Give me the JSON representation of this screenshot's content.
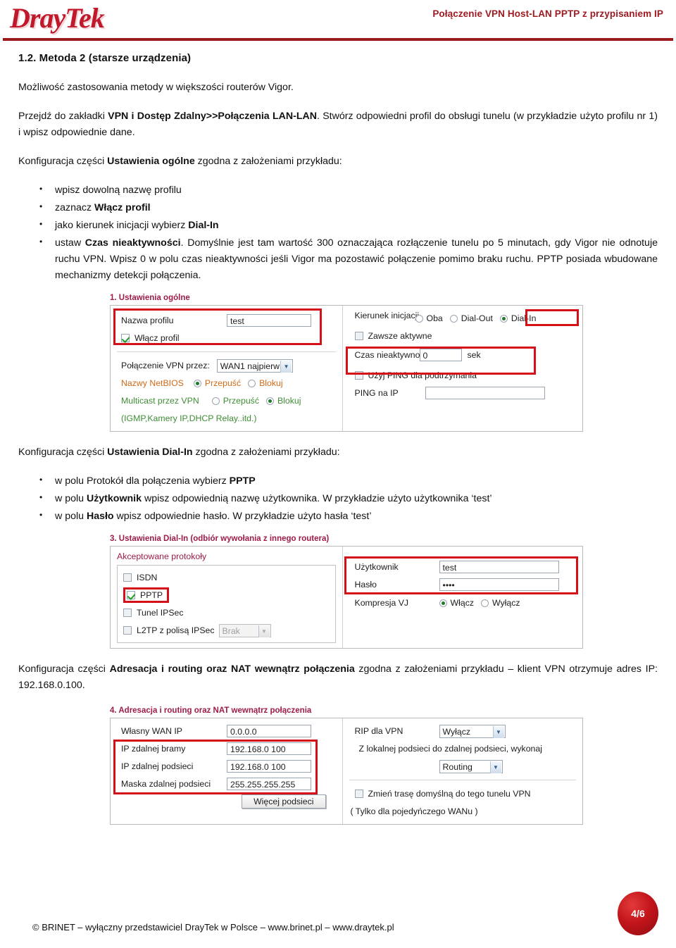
{
  "header": {
    "logo_text": "DrayTek",
    "title": "Połączenie VPN Host-LAN PPTP z przypisaniem IP"
  },
  "section": {
    "heading": "1.2. Metoda 2 (starsze urządzenia)",
    "intro": "Możliwość zastosowania metody w większości routerów Vigor.",
    "nav_para_pre": "Przejdź do zakładki ",
    "nav_para_bold": "VPN i Dostęp Zdalny>>Połączenia LAN-LAN",
    "nav_para_post": ". Stwórz odpowiedni profil do obsługi tunelu (w przykładzie użyto profilu nr 1) i wpisz odpowiednie dane."
  },
  "block_general": {
    "lead_pre": "Konfiguracja części ",
    "lead_bold": "Ustawienia ogólne",
    "lead_post": " zgodna z założeniami przykładu:",
    "bullets": [
      {
        "pre": "wpisz dowolną nazwę profilu",
        "bold": "",
        "post": ""
      },
      {
        "pre": "zaznacz ",
        "bold": "Włącz profil",
        "post": ""
      },
      {
        "pre": "jako kierunek inicjacji wybierz ",
        "bold": "Dial-In",
        "post": ""
      },
      {
        "pre": "ustaw ",
        "bold": "Czas nieaktywności",
        "post": ". Domyślnie jest tam wartość 300 oznaczająca rozłączenie tunelu po 5 minutach, gdy Vigor nie odnotuje ruchu VPN. Wpisz 0 w polu czas nieaktywności jeśli Vigor ma pozostawić połączenie pomimo braku ruchu. PPTP posiada wbudowane mechanizmy detekcji połączenia."
      }
    ]
  },
  "fig1": {
    "caption": "1. Ustawienia ogólne",
    "profile_name_label": "Nazwa profilu",
    "profile_name_value": "test",
    "enable_profile_label": "Włącz profil",
    "enable_profile_checked": true,
    "vpn_through_label": "Połączenie VPN przez:",
    "vpn_through_value": "WAN1 najpierw",
    "netbios_label": "Nazwy NetBIOS",
    "netbios_pass": "Przepuść",
    "netbios_block": "Blokuj",
    "netbios_selected": "Przepuść",
    "multicast_label": "Multicast przez VPN",
    "multicast_note": "(IGMP,Kamery IP,DHCP Relay..itd.)",
    "multicast_pass": "Przepuść",
    "multicast_block": "Blokuj",
    "multicast_selected": "Blokuj",
    "direction_label": "Kierunek inicjacji",
    "direction_options": [
      "Oba",
      "Dial-Out",
      "Dial-In"
    ],
    "direction_selected": "Dial-In",
    "always_on_label": "Zawsze aktywne",
    "always_on_checked": false,
    "idle_label": "Czas nieaktywności",
    "idle_value": "0",
    "idle_unit": "sek",
    "ping_keepalive_label": "Użyj PING dla podtrzymania",
    "ping_keepalive_checked": false,
    "ping_ip_label": "PING na IP",
    "ping_ip_value": ""
  },
  "block_dialin": {
    "lead_pre": "Konfiguracja części ",
    "lead_bold": "Ustawienia Dial-In",
    "lead_post": " zgodna z założeniami przykładu:",
    "bullets": [
      {
        "pre": "w polu Protokół dla połączenia wybierz ",
        "bold": "PPTP",
        "post": ""
      },
      {
        "pre": "w polu ",
        "bold": "Użytkownik",
        "post": " wpisz odpowiednią nazwę użytkownika. W przykładzie użyto użytkownika ‘test’"
      },
      {
        "pre": "w polu ",
        "bold": "Hasło",
        "post": " wpisz odpowiednie hasło. W przykładzie użyto hasła ‘test’"
      }
    ]
  },
  "fig3": {
    "caption": "3. Ustawienia Dial-In (odbiór wywołania z innego routera)",
    "protocols_title": "Akceptowane protokoły",
    "protocols": [
      {
        "label": "ISDN",
        "checked": false
      },
      {
        "label": "PPTP",
        "checked": true
      },
      {
        "label": "Tunel IPSec",
        "checked": false
      },
      {
        "label": "L2TP z polisą IPSec",
        "checked": false
      }
    ],
    "l2tp_select_value": "Brak",
    "user_label": "Użytkownik",
    "user_value": "test",
    "password_label": "Hasło",
    "password_value": "••••",
    "vj_label": "Kompresja VJ",
    "vj_on": "Włącz",
    "vj_off": "Wyłącz",
    "vj_selected": "Włącz"
  },
  "block_nat": {
    "lead_pre": "Konfiguracja części ",
    "lead_bold": "Adresacja i routing oraz NAT wewnątrz połączenia",
    "lead_post": " zgodna z założeniami przykładu – klient VPN otrzymuje adres IP: 192.168.0.100."
  },
  "fig4": {
    "caption": "4. Adresacja i routing oraz NAT wewnątrz połączenia",
    "own_wan_ip_label": "Własny WAN IP",
    "own_wan_ip_value": "0.0.0.0",
    "remote_gw_label": "IP zdalnej bramy",
    "remote_gw_value": "192.168.0 100",
    "remote_net_label": "IP zdalnej podsieci",
    "remote_net_value": "192.168.0 100",
    "remote_mask_label": "Maska zdalnej podsieci",
    "remote_mask_value": "255.255.255.255",
    "more_subnets_button": "Więcej podsieci",
    "rip_label": "RIP dla VPN",
    "rip_value": "Wyłącz",
    "route_text": "Z lokalnej podsieci do zdalnej podsieci, wykonaj",
    "route_value": "Routing",
    "default_route_label": "Zmień trasę domyślną do tego tunelu VPN",
    "default_route_note": "( Tylko dla pojedyńczego WANu )",
    "default_route_checked": false
  },
  "footer": {
    "text": "© BRINET – wyłączny przedstawiciel DrayTek w Polsce – www.brinet.pl – www.draytek.pl",
    "page": "4/6"
  },
  "colors": {
    "brand_red": "#c0192b",
    "rule_red": "#9b1b1f",
    "highlight_red": "#d41118",
    "caption_magenta": "#9e1b4a"
  }
}
